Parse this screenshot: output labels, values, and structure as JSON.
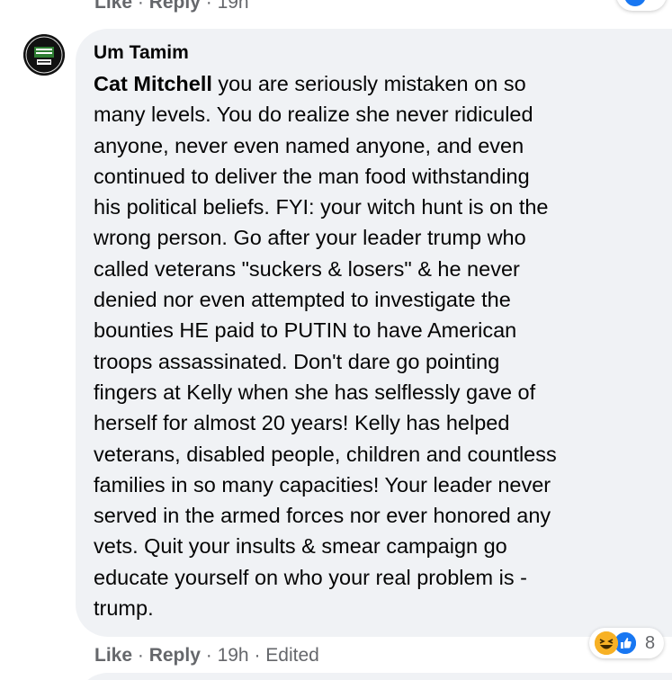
{
  "top_actions": {
    "like": "Like",
    "sep1": "·",
    "reply": "Reply",
    "sep2": "·",
    "time": "19h"
  },
  "comment": {
    "author": "Um Tamim",
    "mention": "Cat Mitchell",
    "lines": [
      " you are seriously mistaken on so",
      "many levels. You do realize she never ridiculed",
      "anyone, never even named anyone, and even",
      "continued to deliver the man food withstanding",
      "his political beliefs. FYI: your witch hunt is on the",
      "wrong person. Go after your leader trump who",
      "called veterans \"suckers & losers\" & he never",
      "denied nor even attempted to investigate the",
      "bounties HE paid to PUTIN to have American",
      "troops assassinated. Don't dare go pointing",
      "fingers at Kelly when she has selflessly gave of",
      "herself for almost 20 years! Kelly has helped",
      "veterans, disabled people, children and countless",
      "families in so many capacities! Your leader never",
      "served in the armed forces nor ever honored any",
      "vets. Quit your insults & smear campaign go",
      "educate yourself on who your real problem is -",
      "trump."
    ],
    "reactions": {
      "icons": [
        "haha-icon",
        "like-icon"
      ],
      "count": "8"
    },
    "actions": {
      "like": "Like",
      "sep1": "·",
      "reply": "Reply",
      "sep2": "·",
      "time": "19h",
      "sep3": "·",
      "edited": "Edited"
    }
  },
  "colors": {
    "bubble": "#f0f2f5",
    "meta_text": "#65676b",
    "like_blue": "#1877f2",
    "haha_yellow": "#f7b125"
  }
}
